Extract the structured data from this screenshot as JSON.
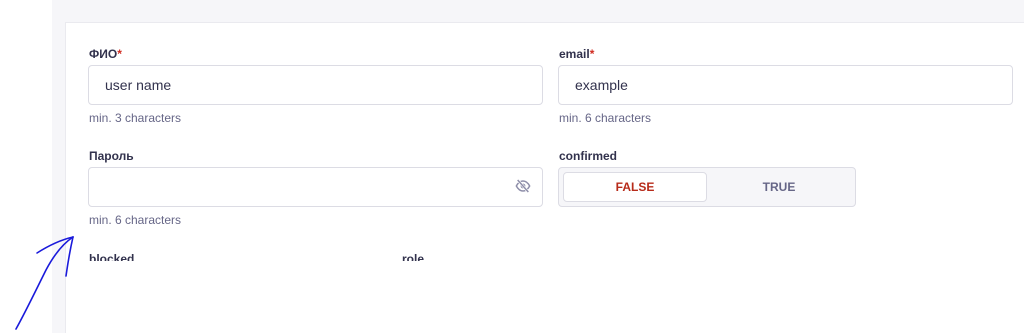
{
  "form": {
    "fio": {
      "label": "ФИО",
      "required_mark": "*",
      "value": "user name",
      "hint": "min. 3 characters"
    },
    "email": {
      "label": "email",
      "required_mark": "*",
      "value": "example",
      "hint": "min. 6 characters"
    },
    "password": {
      "label": "Пароль",
      "value": "",
      "hint": "min. 6 characters",
      "icon": "eye-slash-icon"
    },
    "confirmed": {
      "label": "confirmed",
      "options": [
        "FALSE",
        "TRUE"
      ],
      "selected": "FALSE"
    },
    "blocked": {
      "label": "blocked"
    },
    "role": {
      "label": "role"
    }
  },
  "colors": {
    "required": "#d02b20",
    "selected_false_text": "#b72b1a",
    "annotation_stroke": "#1a1adb"
  }
}
